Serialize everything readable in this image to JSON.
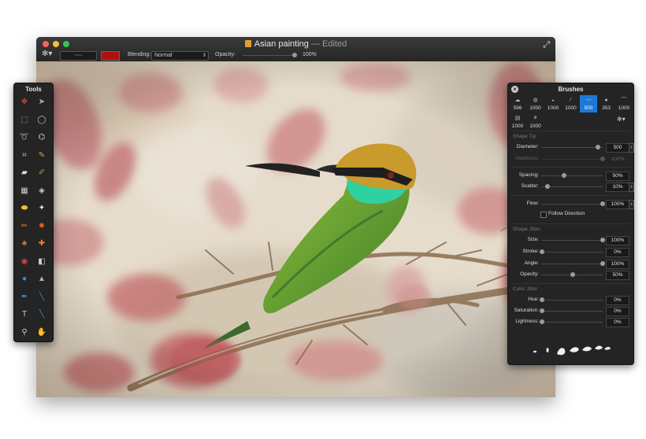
{
  "window": {
    "title": "Asian painting",
    "title_status": "— Edited",
    "fullscreen_glyph": "⤢"
  },
  "toolbar": {
    "gear_glyph": "✻▾",
    "brush_preview_text": "~~~",
    "color_swatch": "#b01010",
    "blending_label": "Blending:",
    "blending_value": "Normal",
    "opacity_label": "Opacity:",
    "opacity_value": "100%",
    "opacity_level": 1.0
  },
  "tools_panel": {
    "title": "Tools",
    "tools": [
      {
        "name": "select-icon",
        "glyph": "✥"
      },
      {
        "name": "move-icon",
        "glyph": "➤"
      },
      {
        "name": "rect-select-icon",
        "glyph": "⬚"
      },
      {
        "name": "ellipse-select-icon",
        "glyph": "◯"
      },
      {
        "name": "lasso-icon",
        "glyph": "➰"
      },
      {
        "name": "polygon-lasso-icon",
        "glyph": "⌬"
      },
      {
        "name": "crop-icon",
        "glyph": "⌗"
      },
      {
        "name": "eyedropper-icon",
        "glyph": "✎"
      },
      {
        "name": "eraser-icon",
        "glyph": "▰"
      },
      {
        "name": "brush-icon",
        "glyph": "✐"
      },
      {
        "name": "gradient-icon",
        "glyph": "▦"
      },
      {
        "name": "paint-bucket-icon",
        "glyph": "◈"
      },
      {
        "name": "smudge-icon",
        "glyph": "⬬"
      },
      {
        "name": "sharpen-icon",
        "glyph": "✦"
      },
      {
        "name": "pencil-icon",
        "glyph": "✏"
      },
      {
        "name": "burn-icon",
        "glyph": "✹"
      },
      {
        "name": "clone-stamp-icon",
        "glyph": "♣"
      },
      {
        "name": "heal-icon",
        "glyph": "✚"
      },
      {
        "name": "red-eye-icon",
        "glyph": "◉"
      },
      {
        "name": "dodge-icon",
        "glyph": "◧"
      },
      {
        "name": "blur-icon",
        "glyph": "●"
      },
      {
        "name": "sponge-icon",
        "glyph": "▲"
      },
      {
        "name": "pen-icon",
        "glyph": "✒"
      },
      {
        "name": "line-icon",
        "glyph": "╲"
      },
      {
        "name": "text-icon",
        "glyph": "T"
      },
      {
        "name": "shape-icon",
        "glyph": "╲"
      },
      {
        "name": "zoom-icon",
        "glyph": "⚲"
      },
      {
        "name": "hand-icon",
        "glyph": "✋"
      }
    ]
  },
  "brushes_panel": {
    "title": "Brushes",
    "close_glyph": "×",
    "presets": [
      {
        "size": "596",
        "tip": "☁"
      },
      {
        "size": "1000",
        "tip": "◍"
      },
      {
        "size": "1000",
        "tip": "◒"
      },
      {
        "size": "1000",
        "tip": "⁄"
      },
      {
        "size": "500",
        "tip": "⁓",
        "selected": true
      },
      {
        "size": "353",
        "tip": "●"
      },
      {
        "size": "1000",
        "tip": "⌒"
      },
      {
        "size": "1000",
        "tip": "▤"
      },
      {
        "size": "1000",
        "tip": "⚘"
      }
    ],
    "gear_glyph": "✻▾",
    "shape_tip": {
      "title": "Shape Tip",
      "diameter": {
        "label": "Diameter:",
        "value": "500",
        "level": 0.5
      },
      "hardness": {
        "label": "Hardness:",
        "value": "100%",
        "level": 1.0
      },
      "spacing": {
        "label": "Spacing:",
        "value": "50%",
        "level": 0.5
      },
      "scatter": {
        "label": "Scatter:",
        "value": "10%",
        "level": 0.1
      },
      "flow": {
        "label": "Flow:",
        "value": "100%",
        "level": 1.0
      },
      "follow_direction": "Follow Direction"
    },
    "shape_jitter": {
      "title": "Shape Jitter",
      "size": {
        "label": "Size:",
        "value": "100%",
        "level": 1.0
      },
      "stroke": {
        "label": "Stroke:",
        "value": "0%",
        "level": 0.0
      },
      "angle": {
        "label": "Angle:",
        "value": "100%",
        "level": 1.0
      },
      "opacity": {
        "label": "Opacity:",
        "value": "50%",
        "level": 0.5
      }
    },
    "color_jitter": {
      "title": "Color Jitter",
      "hue": {
        "label": "Hue:",
        "value": "0%",
        "level": 0.0
      },
      "saturation": {
        "label": "Saturation:",
        "value": "0%",
        "level": 0.0
      },
      "lightness": {
        "label": "Lightness:",
        "value": "0%",
        "level": 0.0
      }
    }
  }
}
